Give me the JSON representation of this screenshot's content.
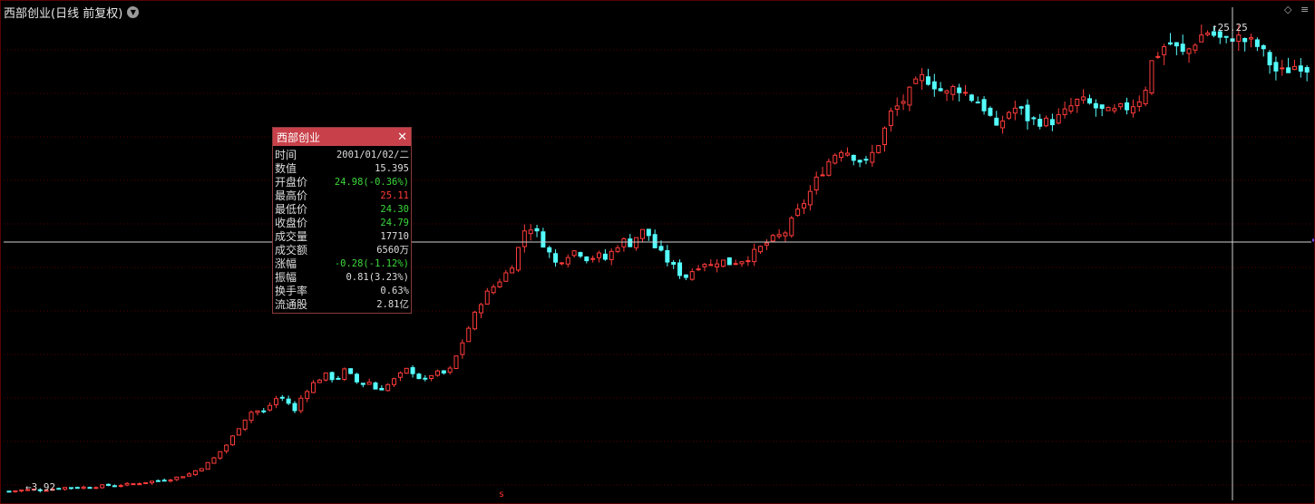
{
  "title": "西部创业(日线 前复权)",
  "colors": {
    "up": "#ff3b3b",
    "down": "#54ffff",
    "grid": "#5a0000",
    "crosshair": "#cfcfcf",
    "header": "#c8414a"
  },
  "icons": {
    "dropdown": "chevron-down-icon",
    "diamond": "diamond-icon",
    "menu": "menu-icon",
    "close": "close-icon"
  },
  "labels": {
    "high_price": "25.25",
    "low_price": "3.92",
    "marker": "s"
  },
  "info": {
    "title": "西部创业",
    "rows": [
      {
        "label": "时间",
        "value": "2001/01/02/二",
        "color": "#dddddd"
      },
      {
        "label": "数值",
        "value": "15.395",
        "color": "#dddddd"
      },
      {
        "label": "开盘价",
        "value": "24.98(-0.36%)",
        "color": "#3bd93b"
      },
      {
        "label": "最高价",
        "value": "25.11",
        "color": "#ff3b3b"
      },
      {
        "label": "最低价",
        "value": "24.30",
        "color": "#3bd93b"
      },
      {
        "label": "收盘价",
        "value": "24.79",
        "color": "#3bd93b"
      },
      {
        "label": "成交量",
        "value": "17710",
        "color": "#dddddd"
      },
      {
        "label": "成交额",
        "value": "6560万",
        "color": "#dddddd"
      },
      {
        "label": "涨幅",
        "value": "-0.28(-1.12%)",
        "color": "#3bd93b"
      },
      {
        "label": "振幅",
        "value": "0.81(3.23%)",
        "color": "#dddddd"
      },
      {
        "label": "换手率",
        "value": "0.63%",
        "color": "#dddddd"
      },
      {
        "label": "流通股",
        "value": "2.81亿",
        "color": "#dddddd"
      }
    ]
  },
  "chart_data": {
    "type": "candlestick",
    "ylim": [
      3.5,
      26.2
    ],
    "grid": true,
    "crosshair": {
      "index": 197,
      "price": 15.395
    },
    "series_close_path": [
      3.92,
      3.95,
      3.98,
      4.0,
      3.97,
      4.02,
      4.05,
      4.1,
      4.08,
      4.1,
      4.12,
      4.15,
      4.2,
      4.18,
      4.22,
      4.25,
      4.3,
      4.35,
      4.4,
      4.45,
      4.5,
      4.6,
      4.7,
      4.9,
      5.1,
      5.4,
      5.8,
      6.2,
      6.8,
      7.3,
      7.7,
      7.5,
      7.9,
      8.3,
      8.1,
      7.6,
      8.4,
      8.8,
      9.1,
      9.3,
      9.0,
      9.5,
      9.2,
      8.8,
      9.0,
      8.6,
      8.7,
      9.0,
      9.3,
      9.6,
      9.2,
      9.0,
      9.4,
      9.3,
      9.5,
      10.3,
      11.2,
      12.0,
      12.8,
      13.2,
      13.6,
      14.0,
      14.6,
      15.9,
      16.1,
      15.6,
      15.0,
      14.4,
      14.7,
      15.0,
      14.9,
      14.6,
      14.8,
      14.6,
      15.0,
      15.5,
      15.3,
      15.7,
      16.0,
      15.2,
      14.8,
      14.4,
      14.0,
      13.8,
      14.2,
      14.5,
      14.3,
      14.6,
      14.4,
      14.5,
      14.6,
      14.8,
      15.1,
      15.4,
      15.6,
      15.8,
      16.4,
      17.0,
      17.6,
      18.3,
      18.9,
      19.4,
      19.7,
      19.5,
      19.2,
      19.0,
      19.6,
      20.3,
      21.3,
      21.7,
      22.1,
      22.6,
      23.0,
      22.8,
      22.4,
      22.2,
      22.6,
      22.3,
      22.0,
      21.8,
      21.3,
      20.5,
      21.2,
      21.6,
      21.4,
      21.0,
      21.0,
      20.9,
      21.0,
      21.2,
      21.6,
      21.9,
      21.8,
      21.6,
      21.4,
      21.3,
      21.5,
      21.6,
      21.8,
      22.2,
      23.7,
      24.2,
      24.6,
      24.3,
      24.0,
      24.5,
      24.9,
      25.1,
      24.8,
      24.6,
      24.9,
      24.7,
      24.6,
      24.4,
      23.9,
      23.3,
      23.2,
      23.4,
      23.6,
      23.4
    ]
  }
}
